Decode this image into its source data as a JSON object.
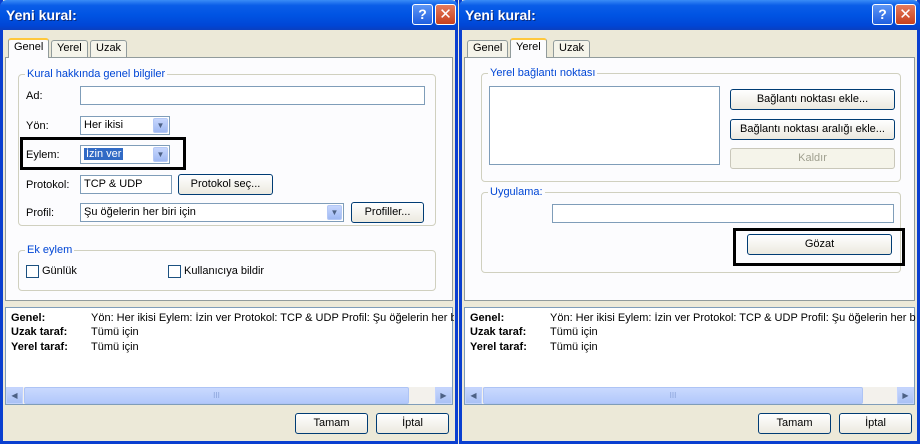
{
  "left": {
    "title": "Yeni kural:",
    "help": "?",
    "close": "✕",
    "tabs": [
      "Genel",
      "Yerel",
      "Uzak"
    ],
    "group_general": "Kural hakkında genel bilgiler",
    "name_label": "Ad:",
    "name_value": "",
    "direction_label": "Yön:",
    "direction_value": "Her ikisi",
    "action_label": "Eylem:",
    "action_value": "İzin ver",
    "protocol_label": "Protokol:",
    "protocol_value": "TCP & UDP",
    "protocol_button": "Protokol seç...",
    "profile_label": "Profil:",
    "profile_value": "Şu öğelerin her biri için",
    "profiles_button": "Profiller...",
    "group_extra": "Ek eylem",
    "log_label": "Günlük",
    "notify_label": "Kullanıcıya bildir",
    "ok": "Tamam",
    "cancel": "İptal"
  },
  "right": {
    "title": "Yeni kural:",
    "help": "?",
    "close": "✕",
    "tabs": [
      "Genel",
      "Yerel",
      "Uzak"
    ],
    "group_endpoint": "Yerel bağlantı noktası",
    "add_port": "Bağlantı noktası ekle...",
    "add_range": "Bağlantı noktası aralığı ekle...",
    "remove": "Kaldır",
    "group_app": "Uygulama:",
    "app_value": "",
    "browse": "Gözat",
    "ok": "Tamam",
    "cancel": "İptal"
  },
  "summary": {
    "general_key": "Genel:",
    "general_val": "Yön: Her ikisi   Eylem: İzin ver   Protokol: TCP & UDP   Profil: Şu öğelerin her biri için",
    "remote_key": "Uzak taraf:",
    "remote_val": "Tümü için",
    "local_key": "Yerel taraf:",
    "local_val": "Tümü için",
    "thumb_mark": "III",
    "left_arrow": "◀",
    "right_arrow": "▶"
  },
  "icons": {
    "dropdown": "▼"
  }
}
